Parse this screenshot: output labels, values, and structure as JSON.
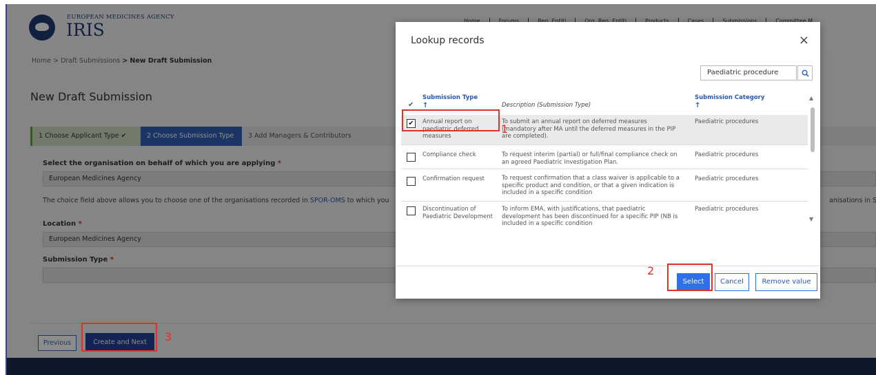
{
  "header": {
    "agency": "EUROPEAN MEDICINES AGENCY",
    "app_name": "IRIS",
    "nav": [
      "Home",
      "Forums",
      "Reg. Entiti",
      "Org. Reg. Entiti",
      "Products",
      "Cases",
      "Submissions",
      "Committee M"
    ]
  },
  "breadcrumb": {
    "home": "Home",
    "drafts": "Draft Submissions",
    "current": "New Draft Submission",
    "sep": ">"
  },
  "page_title": "New Draft Submission",
  "steps": [
    "1  Choose Applicant Type ✔",
    "2  Choose Submission Type",
    "3  Add Managers & Contributors"
  ],
  "form": {
    "org_label": "Select the organisation on behalf of which you are applying",
    "org_value": "European Medicines Agency",
    "info_prefix": "The choice field above allows you to choose one of the organisations recorded in ",
    "info_link": "SPOR-OMS",
    "info_suffix": " to which you",
    "info_right": "anisations in SPOR",
    "location_label": "Location",
    "location_value": "European Medicines Agency",
    "subtype_label": "Submission Type",
    "subtype_value": "",
    "required_mark": "*"
  },
  "buttons": {
    "previous": "Previous",
    "create_next": "Create and Next"
  },
  "modal": {
    "title": "Lookup records",
    "close": "×",
    "search_value": "Paediatric procedure",
    "columns": {
      "check": "✔",
      "type": "Submission Type",
      "description": "Description (Submission Type)",
      "category": "Submission Category",
      "sort_arrow": "↑"
    },
    "rows": [
      {
        "checked": true,
        "type": "Annual report on paediatric deferred measures",
        "description": "To submit an annual report on deferred measures (mandatory after MA until the deferred measures in the PIP are completed).",
        "category": "Paediatric procedures"
      },
      {
        "checked": false,
        "type": "Compliance check",
        "description": "To request interim (partial) or full/final compliance check on an agreed Paediatric Investigation Plan.",
        "category": "Paediatric procedures"
      },
      {
        "checked": false,
        "type": "Confirmation request",
        "description": "To request confirmation that a class waiver is applicable to a specific product and condition, or that a given indication is included in a specific condition",
        "category": "Paediatric procedures"
      },
      {
        "checked": false,
        "type": "Discontinuation of Paediatric Development",
        "description": "To inform EMA, with justifications, that paediatric development has been discontinued for a specific PIP (NB is included in a specific condition",
        "category": "Paediatric procedures"
      }
    ],
    "select": "Select",
    "cancel": "Cancel",
    "remove": "Remove value"
  },
  "annotations": [
    "1",
    "2",
    "3"
  ],
  "colors": {
    "primary": "#2f6fe8",
    "nav_dark": "#1d2c4a",
    "annotation_red": "#e0302a"
  }
}
